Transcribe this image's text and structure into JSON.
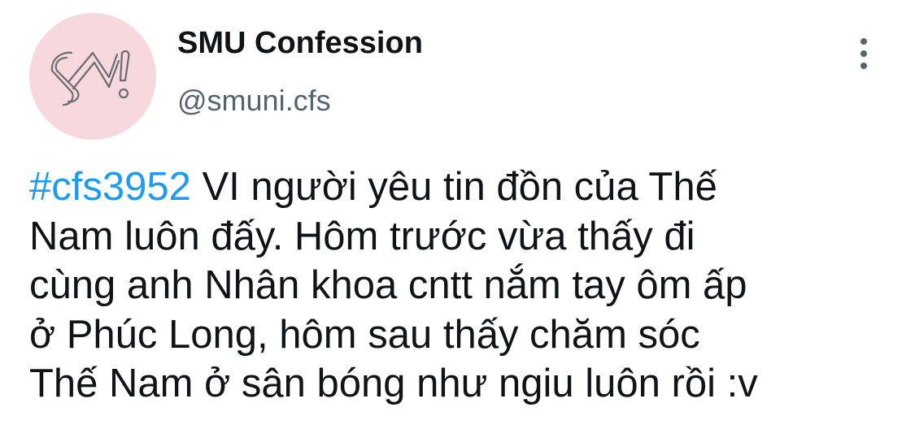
{
  "author": {
    "display_name": "SMU Confession",
    "handle": "@smuni.cfs",
    "avatar_icon": "sm-logo-icon",
    "avatar_bg": "#f7d9dd"
  },
  "menu": {
    "icon": "more-vertical-icon"
  },
  "tweet": {
    "hashtag": "#cfs3952",
    "lines": [
      " VI người yêu tin đồn của Thế",
      "Nam luôn đấy. Hôm trước vừa thấy đi",
      "cùng anh Nhân khoa cntt nắm tay ôm ấp",
      "ở Phúc Long, hôm sau thấy chăm sóc",
      "Thế Nam ở sân bóng như ngiu luôn rồi :v"
    ]
  },
  "colors": {
    "link": "#1d9bf0",
    "secondary_text": "#536471",
    "primary_text": "#0f1419"
  }
}
